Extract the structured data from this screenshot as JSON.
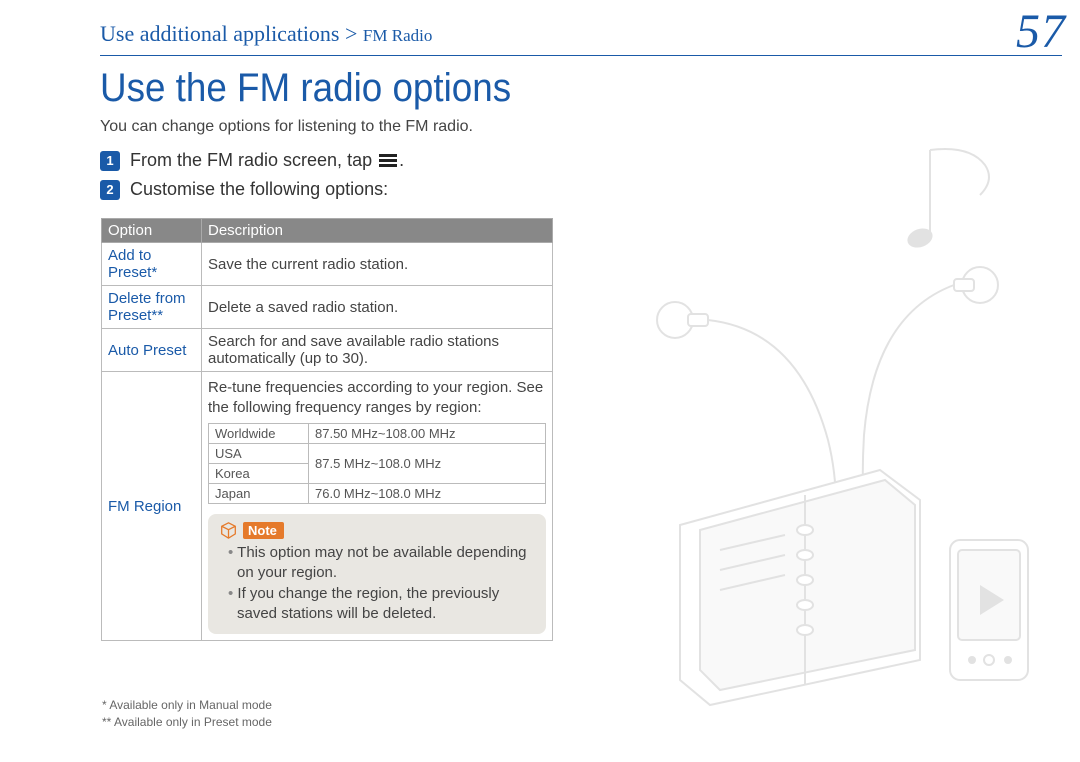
{
  "breadcrumb": {
    "section": "Use additional applications",
    "separator": " > ",
    "subsection": "FM Radio"
  },
  "page_number": "57",
  "heading": "Use the FM radio options",
  "intro": "You can change options for listening to the FM radio.",
  "steps": [
    {
      "num": "1",
      "text_before": "From the FM radio screen, tap ",
      "text_after": "."
    },
    {
      "num": "2",
      "text_before": "Customise the following options:",
      "text_after": ""
    }
  ],
  "table_headers": {
    "option": "Option",
    "description": "Description"
  },
  "options": {
    "add_to_preset": {
      "name": "Add to Preset*",
      "desc": "Save the current radio station."
    },
    "delete_from_preset": {
      "name": "Delete from Preset**",
      "desc": "Delete a saved radio station."
    },
    "auto_preset": {
      "name": "Auto Preset",
      "desc": "Search for and save available radio stations automatically (up to 30)."
    },
    "fm_region": {
      "name": "FM Region",
      "desc": "Re-tune frequencies according to your region. See the following frequency ranges by region:",
      "freq_table": {
        "rows": [
          {
            "region": "Worldwide",
            "range": "87.50 MHz~108.00 MHz"
          },
          {
            "region_a": "USA",
            "region_b": "Korea",
            "range": "87.5 MHz~108.0 MHz"
          },
          {
            "region": "Japan",
            "range": "76.0 MHz~108.0 MHz"
          }
        ]
      },
      "note_label": "Note",
      "notes": [
        "This option may not be available depending on your region.",
        "If you change the region, the previously saved stations will be deleted."
      ]
    }
  },
  "footnotes": {
    "f1": "* Available only in Manual mode",
    "f2": "** Available only in Preset mode"
  }
}
